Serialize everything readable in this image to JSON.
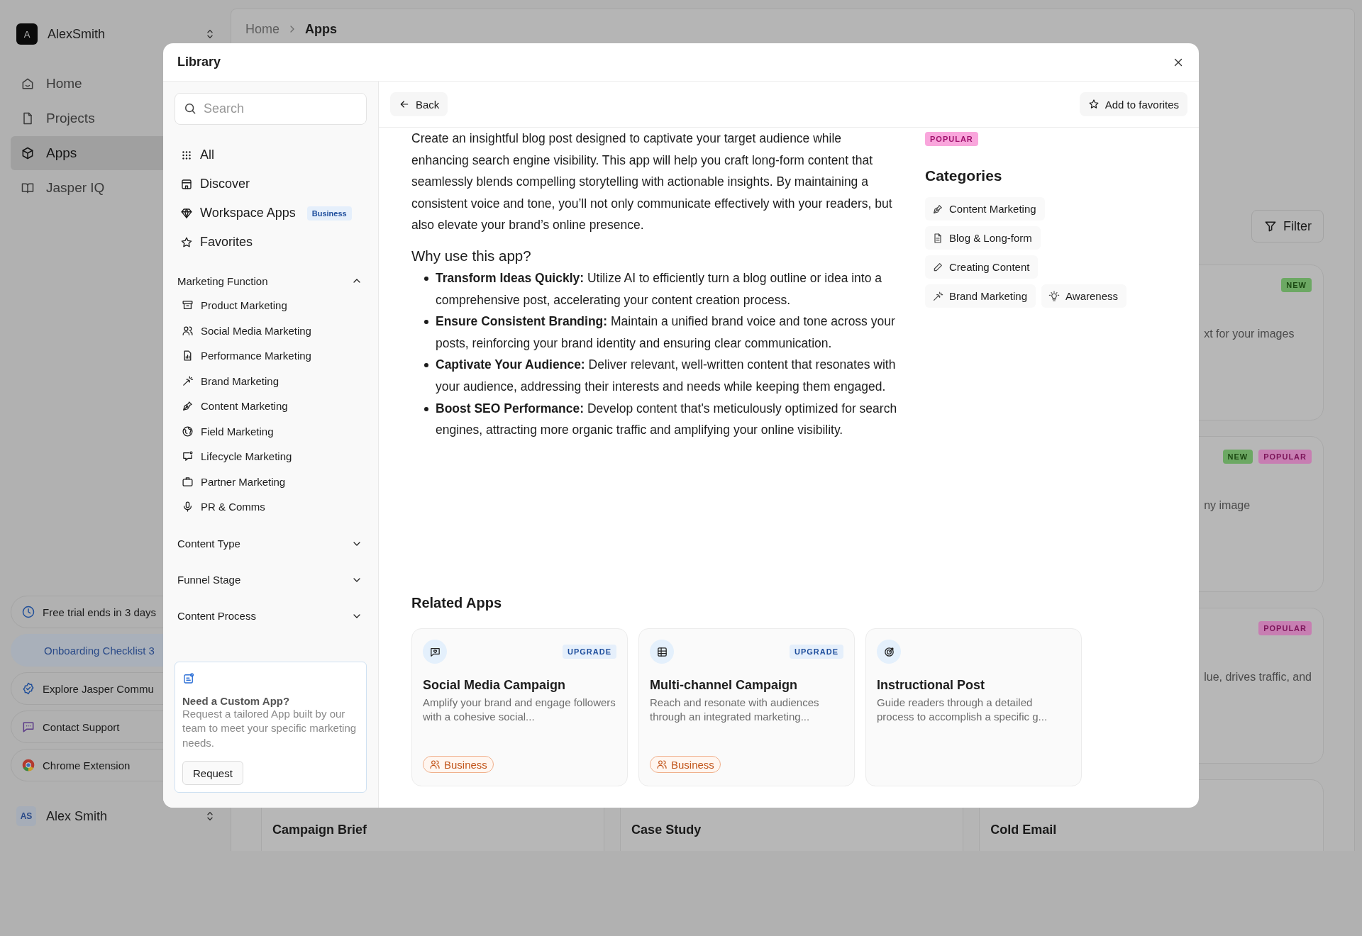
{
  "sidebar": {
    "workspace": {
      "initial": "A",
      "name": "AlexSmith"
    },
    "nav": [
      {
        "label": "Home",
        "selected": false
      },
      {
        "label": "Projects",
        "selected": false
      },
      {
        "label": "Apps",
        "selected": true
      },
      {
        "label": "Jasper IQ",
        "selected": false
      }
    ],
    "bottom_links": [
      {
        "kind": "trial",
        "label": "Free trial ends in 3 days"
      },
      {
        "kind": "checklist",
        "label": "Onboarding Checklist 3"
      },
      {
        "kind": "link",
        "label": "Explore Jasper Commu"
      },
      {
        "kind": "link",
        "label": "Contact Support"
      },
      {
        "kind": "link",
        "label": "Chrome Extension"
      }
    ],
    "user": {
      "initials": "AS",
      "name": "Alex Smith"
    }
  },
  "breadcrumb": [
    {
      "label": "Home",
      "current": false
    },
    {
      "label": "Apps",
      "current": true
    }
  ],
  "filter_button": {
    "label": "Filter"
  },
  "app_cards": [
    {
      "badges": [
        {
          "kind": "new",
          "label": "NEW"
        }
      ],
      "description": "xt for your images"
    },
    {
      "badges": [
        {
          "kind": "new",
          "label": "NEW"
        },
        {
          "kind": "popular",
          "label": "POPULAR"
        }
      ],
      "description": "ny image"
    },
    {
      "badges": [
        {
          "kind": "popular",
          "label": "POPULAR"
        }
      ],
      "description": "lue, drives traffic, and"
    }
  ],
  "bottom_cards": [
    {
      "title": "Campaign Brief"
    },
    {
      "title": "Case Study"
    },
    {
      "title": "Cold Email"
    }
  ],
  "library": {
    "title": "Library",
    "search": {
      "placeholder": "Search"
    },
    "nav": [
      {
        "label": "All",
        "selected": false
      },
      {
        "label": "Discover",
        "selected": false
      },
      {
        "label": "Workspace Apps",
        "badge": "Business",
        "selected": false
      },
      {
        "label": "Favorites",
        "selected": false
      }
    ],
    "sections": [
      {
        "title": "Marketing Function",
        "expanded": true,
        "items": [
          "Product Marketing",
          "Social Media Marketing",
          "Performance Marketing",
          "Brand Marketing",
          "Content Marketing",
          "Field Marketing",
          "Lifecycle Marketing",
          "Partner Marketing",
          "PR & Comms"
        ]
      },
      {
        "title": "Content Type",
        "expanded": false
      },
      {
        "title": "Funnel Stage",
        "expanded": false
      },
      {
        "title": "Content Process",
        "expanded": false
      }
    ],
    "custom_app": {
      "title": "Need a Custom App?",
      "text": "Request a tailored App built by our team to meet your specific marketing needs.",
      "button": "Request"
    },
    "back_button": "Back",
    "favorite_button": "Add to favorites",
    "app": {
      "description": "Create an insightful blog post designed to captivate your target audience while enhancing search engine visibility. This app will help you craft long-form content that seamlessly blends compelling storytelling with actionable insights. By maintaining a consistent voice and tone, you’ll not only communicate effectively with your readers, but also elevate your brand’s online presence.",
      "why_heading": "Why use this app?",
      "benefits": [
        "**Transform Ideas Quickly:** Utilize AI to efficiently turn a blog outline or idea into a comprehensive post, accelerating your content creation process.",
        "**Ensure Consistent Branding:** Maintain a unified brand voice and tone across your posts, reinforcing your brand identity and ensuring clear communication.",
        "**Captivate Your Audience:** Deliver relevant, well-written content that resonates with your audience, addressing their interests and needs while keeping them engaged.",
        "**Boost SEO Performance:** Develop content that's meticulously optimized for search engines, attracting more organic traffic and amplifying your online visibility."
      ],
      "badges": [
        {
          "kind": "popular",
          "label": "POPULAR"
        }
      ],
      "categories_heading": "Categories",
      "categories": [
        "Content Marketing",
        "Blog & Long-form",
        "Creating Content",
        "Brand Marketing",
        "Awareness"
      ]
    },
    "related_heading": "Related Apps",
    "related_apps": [
      {
        "title": "Social Media Campaign",
        "description": "Amplify your brand and engage followers with a cohesive social...",
        "badge": "UPGRADE",
        "tier": "Business"
      },
      {
        "title": "Multi-channel Campaign",
        "description": "Reach and resonate with audiences through an integrated marketing...",
        "badge": "UPGRADE",
        "tier": "Business"
      },
      {
        "title": "Instructional Post",
        "description": "Guide readers through a detailed process to accomplish a specific g..."
      }
    ]
  }
}
